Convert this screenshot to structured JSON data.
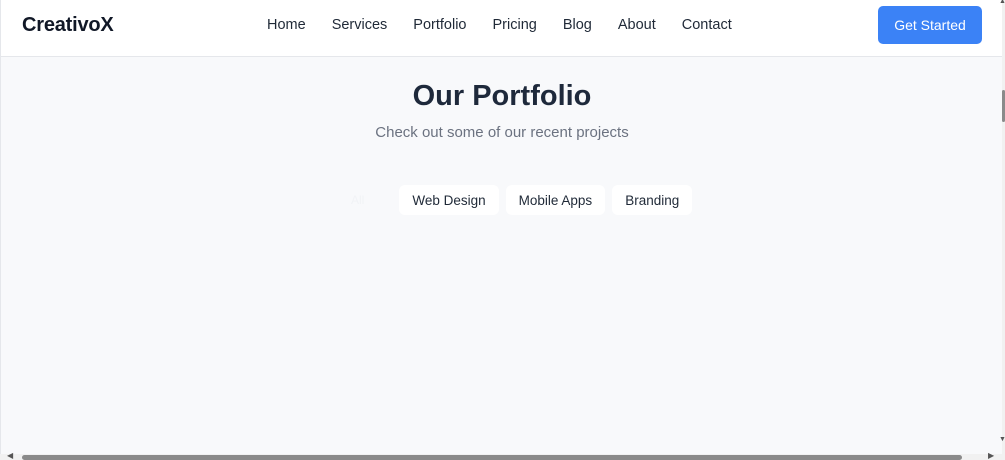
{
  "brand": {
    "logo": "CreativoX"
  },
  "nav": {
    "links": [
      "Home",
      "Services",
      "Portfolio",
      "Pricing",
      "Blog",
      "About",
      "Contact"
    ],
    "cta_label": "Get Started"
  },
  "portfolio": {
    "title": "Our Portfolio",
    "subtitle": "Check out some of our recent projects",
    "filters": [
      {
        "label": "All",
        "active": true
      },
      {
        "label": "Web Design",
        "active": false
      },
      {
        "label": "Mobile Apps",
        "active": false
      },
      {
        "label": "Branding",
        "active": false
      }
    ]
  },
  "colors": {
    "accent": "#3b82f6",
    "background": "#f8f9fb",
    "heading": "#1e293b",
    "muted": "#6b7280"
  },
  "icons": {
    "scroll_up": "triangle-up",
    "scroll_down": "triangle-down",
    "scroll_left": "triangle-left",
    "scroll_right": "triangle-right"
  }
}
